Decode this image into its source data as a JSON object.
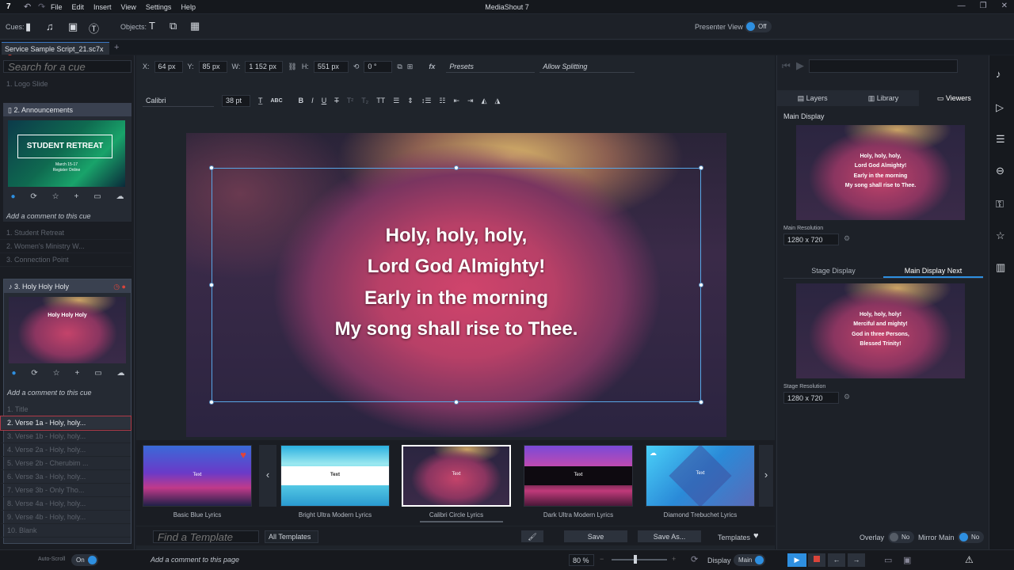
{
  "app": {
    "title": "MediaShout 7",
    "logo": "7",
    "menu": [
      "File",
      "Edit",
      "Insert",
      "View",
      "Settings",
      "Help"
    ]
  },
  "toolbar": {
    "cues_label": "Cues:",
    "objects_label": "Objects:",
    "presenter_view_label": "Presenter View :",
    "presenter_view_value": "Off"
  },
  "tabs": {
    "doc": "Service Sample Script_21.sc7x",
    "add": "+"
  },
  "left": {
    "search_placeholder": "Search for a cue",
    "cue1": "1. Logo Slide",
    "cue2": "2. Announcements",
    "retreat_title": "STUDENT RETREAT",
    "retreat_dates": "March 15-17",
    "retreat_sub": "Register Online",
    "comment": "Add a comment to this cue",
    "ann_items": [
      "1. Student Retreat",
      "2. Women's Ministry W...",
      "3. Connection Point"
    ],
    "cue3": "3. Holy Holy Holy",
    "holy_thumb_title": "Holy Holy Holy",
    "holy_items": [
      "1. Title",
      "2. Verse 1a - Holy, holy...",
      "3. Verse 1b - Holy, holy...",
      "4. Verse 2a - Holy, holy...",
      "5. Verse 2b - Cherubim ...",
      "6. Verse 3a - Holy, holy...",
      "7. Verse 3b - Only Tho...",
      "8. Verse 4a - Holy, holy...",
      "9. Verse 4b - Holy, holy...",
      "10. Blank"
    ],
    "autoscroll_label": "Auto-Scroll",
    "autoscroll_value": "On"
  },
  "props": {
    "x_label": "X:",
    "x": "64 px",
    "y_label": "Y:",
    "y": "85 px",
    "w_label": "W:",
    "w": "1 152 px",
    "h_label": "H:",
    "h": "551 px",
    "rot": "0 °",
    "presets": "Presets",
    "allow": "Allow Splitting",
    "fx": "fx"
  },
  "fmt": {
    "font": "Calibri",
    "size": "38 pt",
    "abc": "ABC",
    "bold": "B",
    "italic": "I",
    "underline": "U",
    "strike": "T",
    "caps": "TT"
  },
  "slide": {
    "lines": [
      "Holy, holy, holy,",
      "Lord God Almighty!",
      "Early in the morning",
      "My song shall rise to Thee."
    ]
  },
  "templates": [
    {
      "label": "Basic Blue Lyrics",
      "text": "Text"
    },
    {
      "label": "Bright Ultra Modern Lyrics",
      "text": "Text"
    },
    {
      "label": "Calibri Circle Lyrics",
      "text": "Text"
    },
    {
      "label": "Dark Ultra Modern Lyrics",
      "text": "Text"
    },
    {
      "label": "Diamond Trebuchet Lyrics",
      "text": "Text"
    }
  ],
  "bottom": {
    "find_placeholder": "Find a Template",
    "all_templates": "All Templates",
    "save": "Save",
    "save_as": "Save As...",
    "templates": "Templates",
    "page_comment": "Add a comment to this page",
    "zoom": "80 %",
    "display_label": "Display",
    "display_value": "Main"
  },
  "right": {
    "tabs": [
      "Layers",
      "Library",
      "Viewers"
    ],
    "main_display": "Main Display",
    "main_lines": [
      "Holy, holy, holy,",
      "Lord God Almighty!",
      "Early in the morning",
      "My song shall rise to Thee."
    ],
    "main_res_label": "Main Resolution",
    "main_res": "1280 x 720",
    "stage_tab": "Stage Display",
    "next_tab": "Main Display Next",
    "next_lines": [
      "Holy, holy, holy!",
      "Merciful and mighty!",
      "God in three Persons,",
      "Blessed Trinity!"
    ],
    "stage_res_label": "Stage Resolution",
    "stage_res": "1280 x 720",
    "overlay_label": "Overlay",
    "overlay_value": "No",
    "mirror_label": "Mirror Main",
    "mirror_value": "No"
  },
  "colors": {
    "accent": "#2e8fe0",
    "stop": "#d9443a"
  }
}
